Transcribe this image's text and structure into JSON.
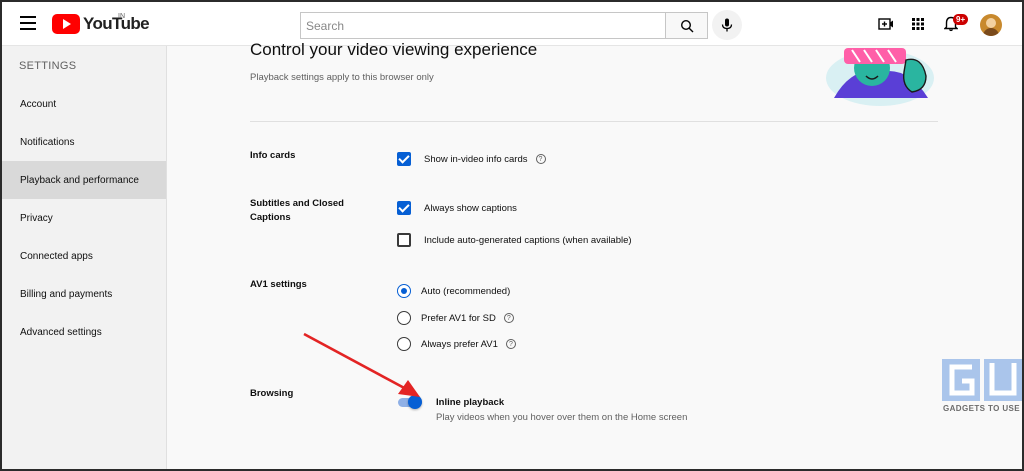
{
  "header": {
    "logo_text": "YouTube",
    "country_code": "IN",
    "search_placeholder": "Search",
    "notification_badge": "9+"
  },
  "sidebar": {
    "heading": "SETTINGS",
    "items": [
      {
        "label": "Account",
        "active": false
      },
      {
        "label": "Notifications",
        "active": false
      },
      {
        "label": "Playback and performance",
        "active": true
      },
      {
        "label": "Privacy",
        "active": false
      },
      {
        "label": "Connected apps",
        "active": false
      },
      {
        "label": "Billing and payments",
        "active": false
      },
      {
        "label": "Advanced settings",
        "active": false
      }
    ]
  },
  "main": {
    "title": "Control your video viewing experience",
    "subtitle": "Playback settings apply to this browser only",
    "sections": {
      "info_cards": {
        "label": "Info cards",
        "options": [
          {
            "label": "Show in-video info cards",
            "checked": true
          }
        ]
      },
      "captions": {
        "label": "Subtitles and Closed Captions",
        "options": [
          {
            "label": "Always show captions",
            "checked": true
          },
          {
            "label": "Include auto-generated captions (when available)",
            "checked": false
          }
        ]
      },
      "av1": {
        "label": "AV1 settings",
        "options": [
          {
            "label": "Auto (recommended)",
            "selected": true
          },
          {
            "label": "Prefer AV1 for SD",
            "selected": false
          },
          {
            "label": "Always prefer AV1",
            "selected": false
          }
        ]
      },
      "browsing": {
        "label": "Browsing",
        "toggle_title": "Inline playback",
        "toggle_desc": "Play videos when you hover over them on the Home screen",
        "enabled": true
      }
    }
  },
  "watermark": {
    "text": "GADGETS TO USE"
  },
  "colors": {
    "accent": "#065fd4",
    "brand_red": "#ff0000",
    "annotation_arrow": "#e32424"
  }
}
